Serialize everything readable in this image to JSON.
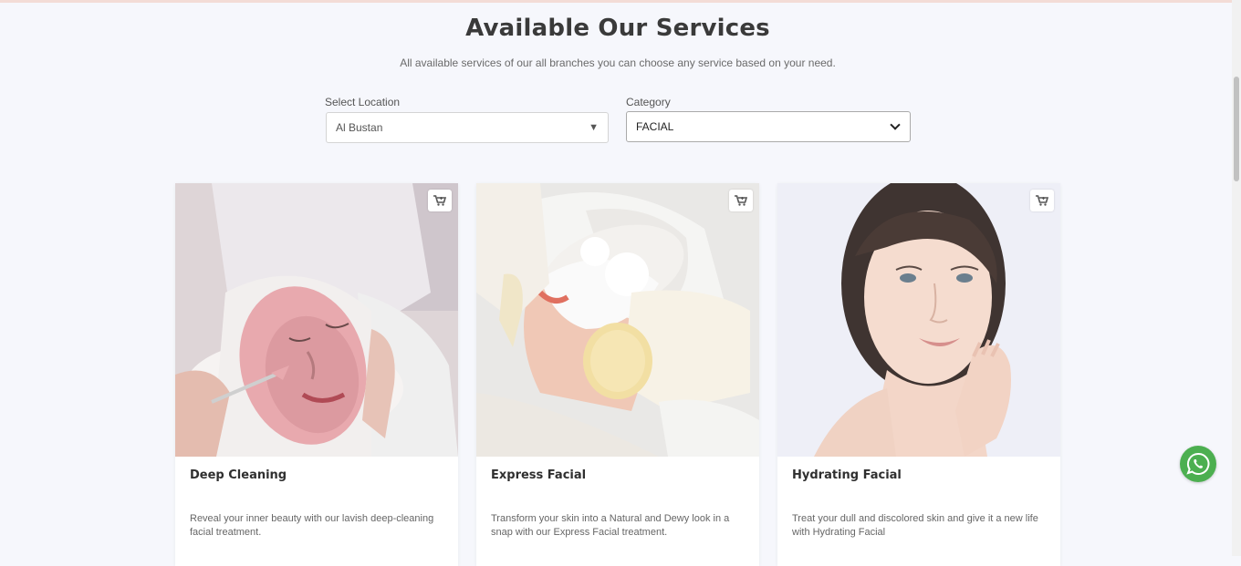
{
  "header": {
    "title": "Available Our Services",
    "subtitle": "All available services of our all branches you can choose any service based on your need."
  },
  "filters": {
    "location": {
      "label": "Select Location",
      "value": "Al Bustan"
    },
    "category": {
      "label": "Category",
      "value": "FACIAL"
    }
  },
  "services": [
    {
      "title": "Deep Cleaning",
      "description": "Reveal your inner beauty with our lavish deep-cleaning facial treatment.",
      "cart_icon": "cart-icon"
    },
    {
      "title": "Express Facial",
      "description": "Transform your skin into a Natural and Dewy look in a snap with our Express Facial treatment.",
      "cart_icon": "cart-icon"
    },
    {
      "title": "Hydrating Facial",
      "description": "Treat your dull and discolored skin and give it a new life with Hydrating Facial",
      "cart_icon": "cart-icon"
    }
  ],
  "floating": {
    "icon": "whatsapp-icon",
    "color": "#4caf50"
  },
  "colors": {
    "page_bg": "#f6f7fc",
    "title": "#3a3a3a",
    "accent_line": "#f3dcd6"
  }
}
